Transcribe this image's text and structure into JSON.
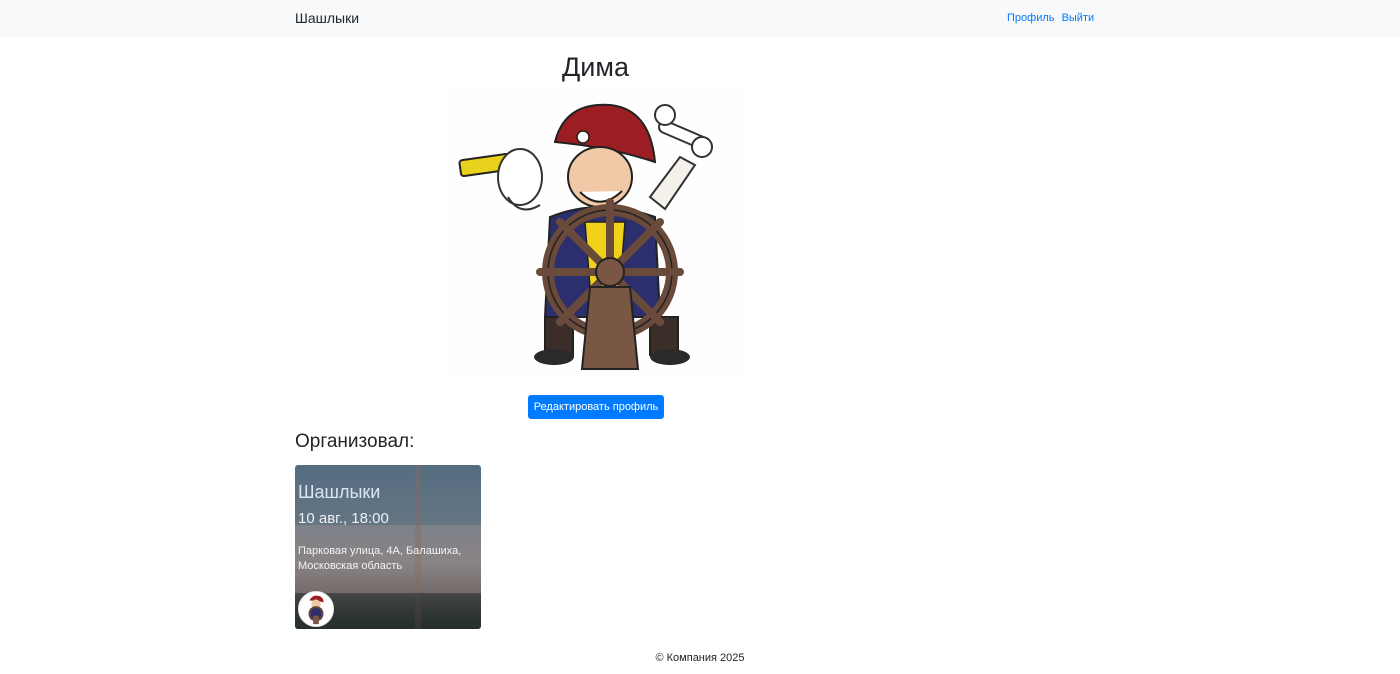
{
  "navbar": {
    "brand": "Шашлыки",
    "links": [
      {
        "label": "Профиль"
      },
      {
        "label": "Выйти"
      }
    ]
  },
  "profile": {
    "name": "Дима",
    "edit_button_label": "Редактировать профиль"
  },
  "organized": {
    "heading": "Организовал:",
    "events": [
      {
        "title": "Шашлыки",
        "datetime": "10 авг., 18:00",
        "address": "Парковая улица, 4А, Балашиха, Московская область"
      }
    ]
  },
  "footer": {
    "text": "© Компания 2025"
  },
  "colors": {
    "link": "#007bff",
    "primary_button": "#007bff",
    "navbar_bg": "#f8f9fa"
  },
  "icons": {
    "avatar": "pirate-avatar-icon"
  }
}
